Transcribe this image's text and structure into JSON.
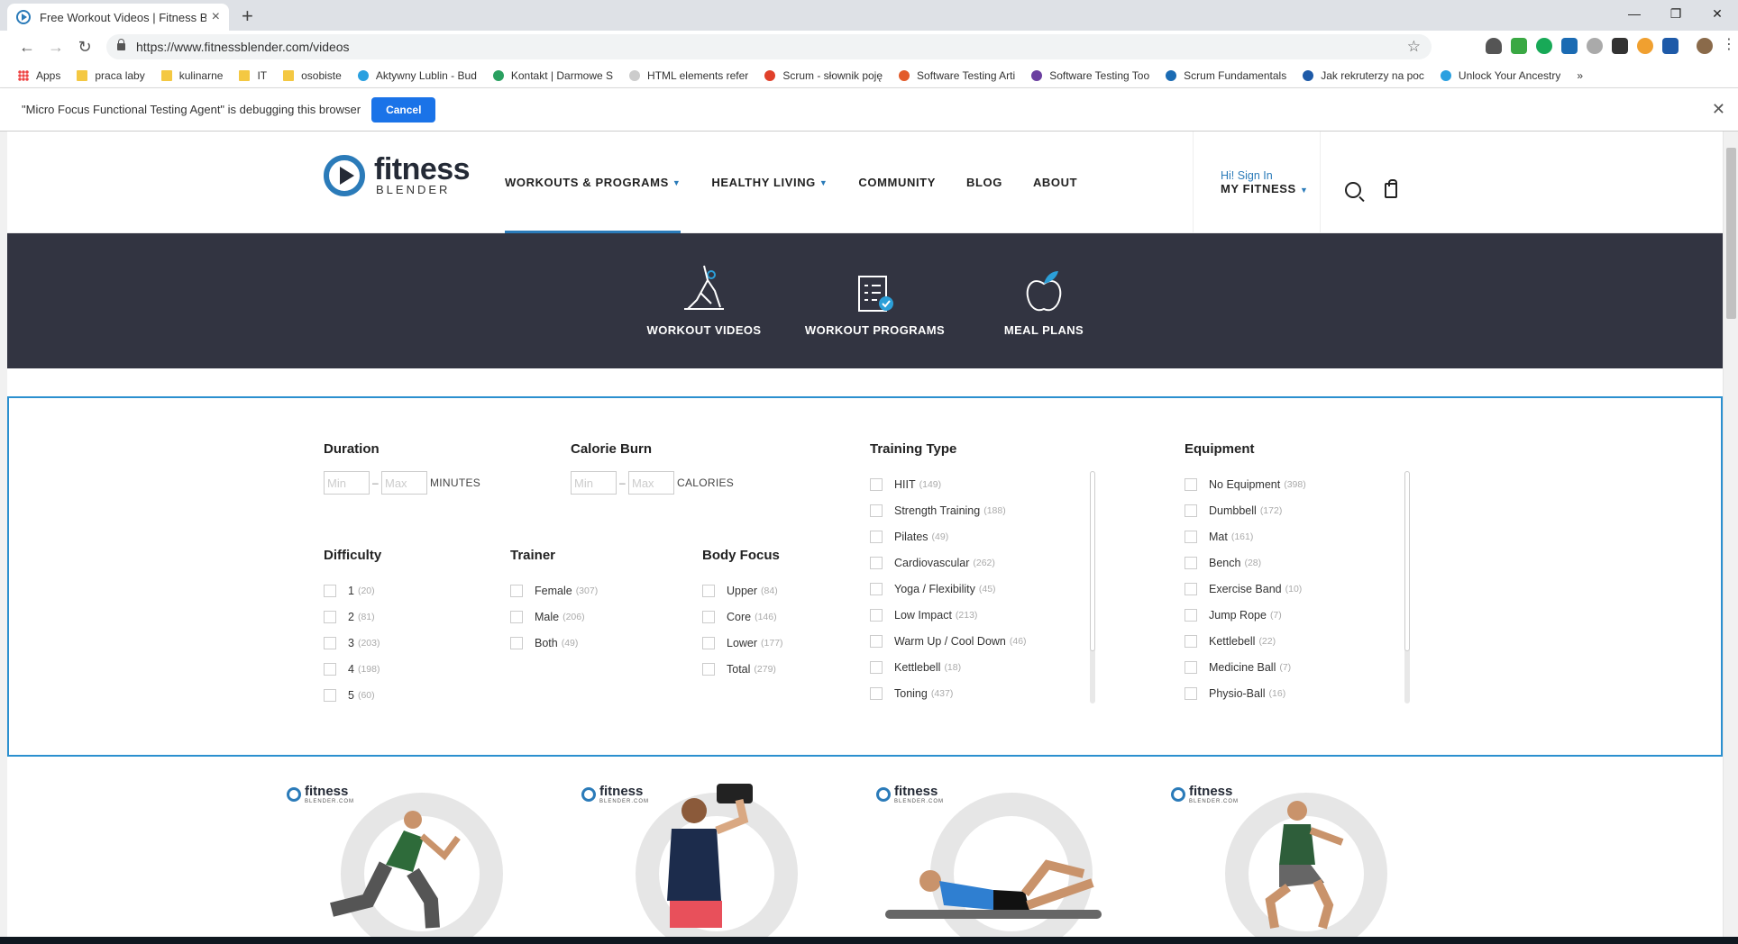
{
  "browser": {
    "tab_title": "Free Workout Videos | Fitness Ble",
    "tab_close": "×",
    "new_tab": "+",
    "url": "https://www.fitnessblender.com/videos",
    "window_controls": [
      "—",
      "❐",
      "✕"
    ],
    "bookmarks": [
      {
        "label": "Apps",
        "icon": "grid"
      },
      {
        "label": "praca laby",
        "icon": "folder"
      },
      {
        "label": "kulinarne",
        "icon": "folder"
      },
      {
        "label": "IT",
        "icon": "folder"
      },
      {
        "label": "osobiste",
        "icon": "folder"
      },
      {
        "label": "Aktywny Lublin - Bud",
        "icon": "site"
      },
      {
        "label": "Kontakt | Darmowe S",
        "icon": "site"
      },
      {
        "label": "HTML elements refer",
        "icon": "site"
      },
      {
        "label": "Scrum - słownik poję",
        "icon": "site"
      },
      {
        "label": "Software Testing Arti",
        "icon": "site"
      },
      {
        "label": "Software Testing Too",
        "icon": "site"
      },
      {
        "label": "Scrum Fundamentals",
        "icon": "site"
      },
      {
        "label": "Jak rekruterzy na poc",
        "icon": "page"
      },
      {
        "label": "Unlock Your Ancestry",
        "icon": "site"
      }
    ],
    "bookmarks_more": "»",
    "debug_message": "\"Micro Focus Functional Testing Agent\" is debugging this browser",
    "debug_cancel": "Cancel",
    "debug_close": "✕"
  },
  "header": {
    "logo_word": "fitness",
    "logo_sub": "BLENDER",
    "nav": [
      {
        "label": "WORKOUTS & PROGRAMS",
        "caret": "▼"
      },
      {
        "label": "HEALTHY LIVING",
        "caret": "▼"
      },
      {
        "label": "COMMUNITY",
        "caret": ""
      },
      {
        "label": "BLOG",
        "caret": ""
      },
      {
        "label": "ABOUT",
        "caret": ""
      }
    ],
    "signin": "Hi! Sign In",
    "my_fitness": "MY FITNESS",
    "caret": "▼"
  },
  "categories": [
    {
      "label": "WORKOUT VIDEOS"
    },
    {
      "label": "WORKOUT PROGRAMS"
    },
    {
      "label": "MEAL PLANS"
    }
  ],
  "filters": {
    "duration": {
      "title": "Duration",
      "min": "Min",
      "max": "Max",
      "unit": "MINUTES"
    },
    "calorie": {
      "title": "Calorie Burn",
      "min": "Min",
      "max": "Max",
      "unit": "CALORIES"
    },
    "difficulty": {
      "title": "Difficulty",
      "options": [
        {
          "label": "1",
          "count": "(20)"
        },
        {
          "label": "2",
          "count": "(81)"
        },
        {
          "label": "3",
          "count": "(203)"
        },
        {
          "label": "4",
          "count": "(198)"
        },
        {
          "label": "5",
          "count": "(60)"
        }
      ]
    },
    "trainer": {
      "title": "Trainer",
      "options": [
        {
          "label": "Female",
          "count": "(307)"
        },
        {
          "label": "Male",
          "count": "(206)"
        },
        {
          "label": "Both",
          "count": "(49)"
        }
      ]
    },
    "body_focus": {
      "title": "Body Focus",
      "options": [
        {
          "label": "Upper",
          "count": "(84)"
        },
        {
          "label": "Core",
          "count": "(146)"
        },
        {
          "label": "Lower",
          "count": "(177)"
        },
        {
          "label": "Total",
          "count": "(279)"
        }
      ]
    },
    "training_type": {
      "title": "Training Type",
      "options": [
        {
          "label": "HIIT",
          "count": "(149)"
        },
        {
          "label": "Strength Training",
          "count": "(188)"
        },
        {
          "label": "Pilates",
          "count": "(49)"
        },
        {
          "label": "Cardiovascular",
          "count": "(262)"
        },
        {
          "label": "Yoga / Flexibility",
          "count": "(45)"
        },
        {
          "label": "Low Impact",
          "count": "(213)"
        },
        {
          "label": "Warm Up / Cool Down",
          "count": "(46)"
        },
        {
          "label": "Kettlebell",
          "count": "(18)"
        },
        {
          "label": "Toning",
          "count": "(437)"
        }
      ]
    },
    "equipment": {
      "title": "Equipment",
      "options": [
        {
          "label": "No Equipment",
          "count": "(398)"
        },
        {
          "label": "Dumbbell",
          "count": "(172)"
        },
        {
          "label": "Mat",
          "count": "(161)"
        },
        {
          "label": "Bench",
          "count": "(28)"
        },
        {
          "label": "Exercise Band",
          "count": "(10)"
        },
        {
          "label": "Jump Rope",
          "count": "(7)"
        },
        {
          "label": "Kettlebell",
          "count": "(22)"
        },
        {
          "label": "Medicine Ball",
          "count": "(7)"
        },
        {
          "label": "Physio-Ball",
          "count": "(16)"
        }
      ]
    }
  },
  "card_logo": {
    "word": "fitness",
    "sub": "BLENDER.COM"
  },
  "cards": [
    {
      "pose": "lunge",
      "shirt": "#2e6b3a",
      "shorts": "#555"
    },
    {
      "pose": "dumbbell",
      "shirt": "#1c2c4c",
      "shorts": "#e8505b"
    },
    {
      "pose": "crunch",
      "shirt": "#2f7fd1",
      "shorts": "#111"
    },
    {
      "pose": "squat",
      "shirt": "#2e5e3a",
      "shorts": "#666"
    }
  ],
  "colors": {
    "accent": "#2b7bb9",
    "dark_band": "#323441",
    "filter_border": "#2b90cf"
  }
}
